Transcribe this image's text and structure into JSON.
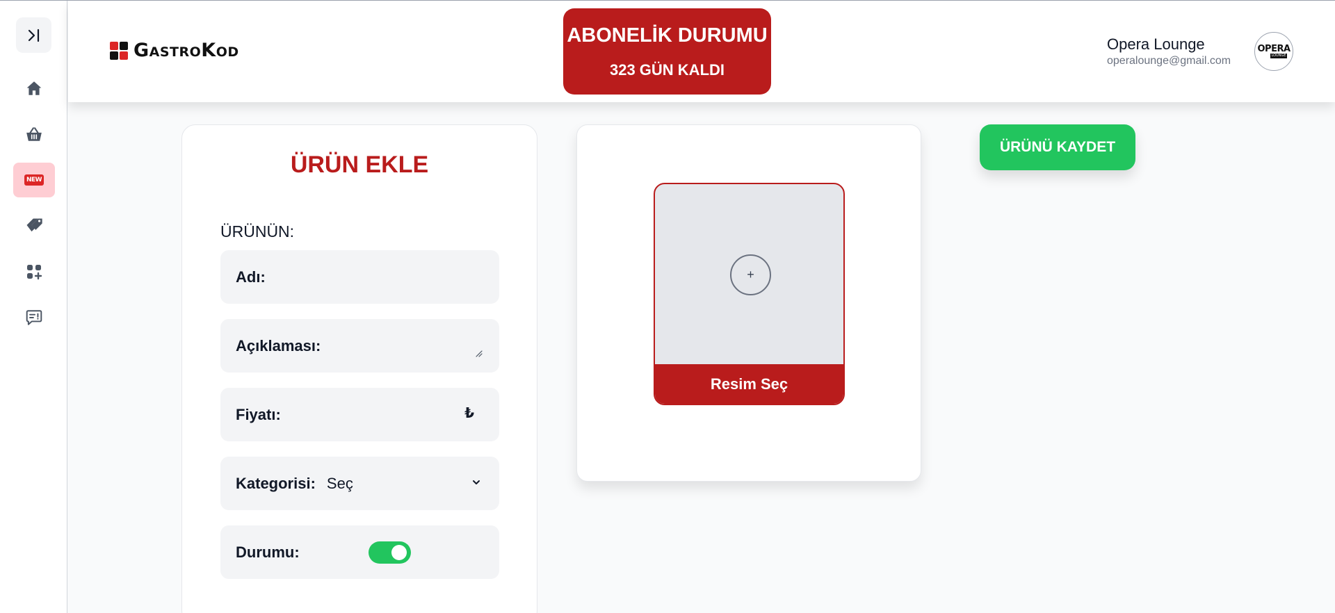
{
  "brand": {
    "logo_text": "GastroKod",
    "logo_colors": [
      "#dc2626",
      "#111111",
      "#111111",
      "#dc2626"
    ]
  },
  "sidebar": {
    "toggle_icon": "collapse-toggle-icon",
    "items": [
      {
        "icon": "home-icon",
        "active": false
      },
      {
        "icon": "basket-icon",
        "active": false
      },
      {
        "icon": "new-badge-icon",
        "label": "NEW",
        "active": true
      },
      {
        "icon": "tags-icon",
        "active": false
      },
      {
        "icon": "add-category-icon",
        "active": false
      },
      {
        "icon": "feedback-icon",
        "active": false
      }
    ]
  },
  "subscription": {
    "title": "ABONELİK DURUMU",
    "days_left": "323 GÜN KALDI",
    "color": "#b91c1c"
  },
  "user": {
    "name": "Opera Lounge",
    "email": "operalounge@gmail.com",
    "avatar_text": "OPERA",
    "avatar_subtext": "LOUNGE"
  },
  "form": {
    "title": "ÜRÜN EKLE",
    "subtitle": "ÜRÜNÜN:",
    "name_label": "Adı:",
    "name_value": "",
    "description_label": "Açıklaması:",
    "description_value": "",
    "price_label": "Fiyatı:",
    "price_value": "",
    "currency_symbol": "₺",
    "category_label": "Kategorisi:",
    "category_selected": "Seç",
    "status_label": "Durumu:",
    "status_on": true
  },
  "image_picker": {
    "plus": "+",
    "button_label": "Resim Seç"
  },
  "actions": {
    "save_label": "ÜRÜNÜ KAYDET",
    "save_color": "#22c55e"
  }
}
